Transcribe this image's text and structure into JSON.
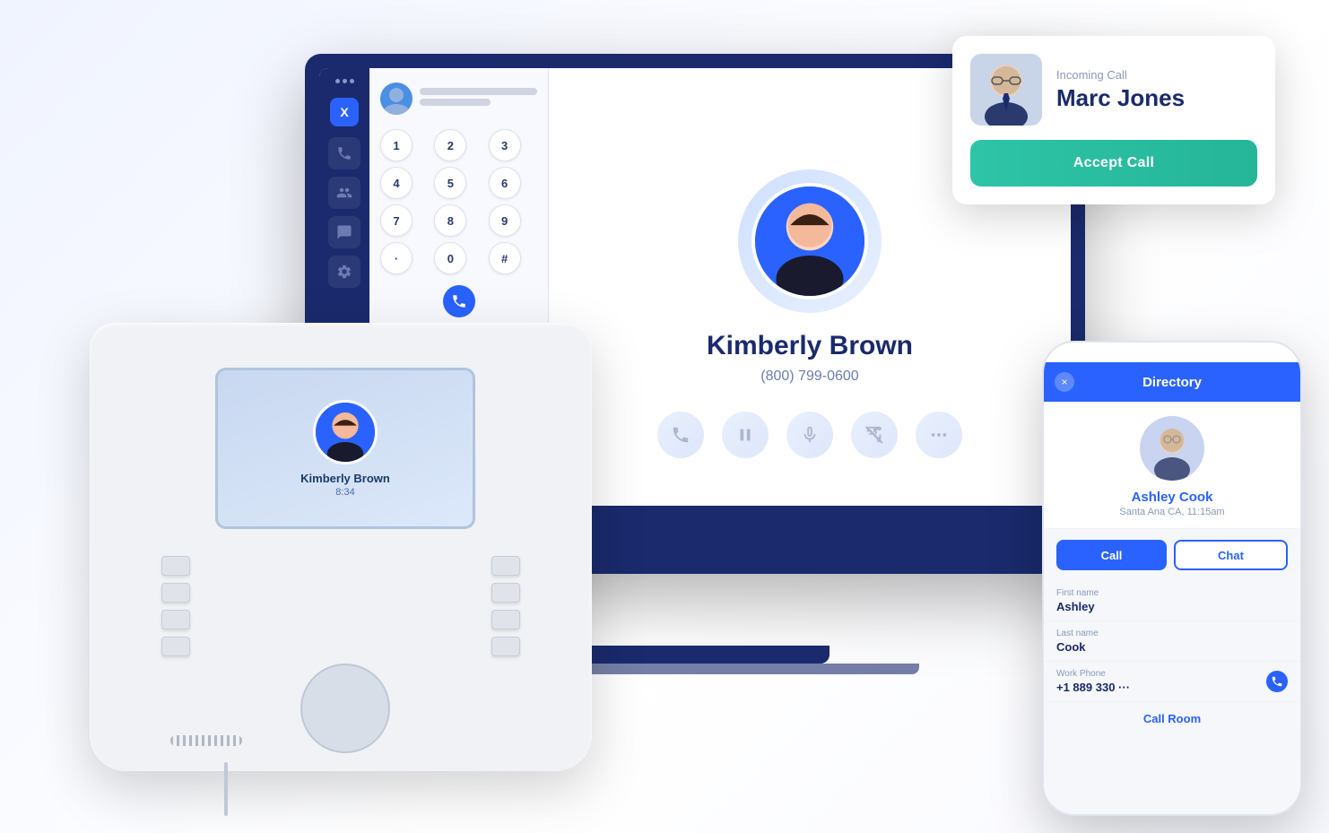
{
  "scene": {
    "bg": "#f5f8ff"
  },
  "incoming_call": {
    "label": "Incoming Call",
    "caller_name": "Marc Jones",
    "accept_label": "Accept Call"
  },
  "laptop": {
    "sidebar": {
      "logo": "X",
      "dots_label": "menu"
    },
    "dialer": {
      "keys": [
        "1",
        "2",
        "3",
        "4",
        "5",
        "6",
        "7",
        "8",
        "9",
        "·",
        "0",
        "#"
      ],
      "call_icon": "phone"
    },
    "contact": {
      "name": "Kimberly Brown",
      "phone": "(800) 799-0600",
      "action_icons": [
        "phone",
        "pause",
        "mute",
        "end",
        "more"
      ]
    }
  },
  "deskphone": {
    "contact_name": "Kimberly Brown",
    "timer": "8:34"
  },
  "mobile": {
    "header_title": "Directory",
    "close_icon": "×",
    "contact": {
      "name": "Ashley Cook",
      "location": "Santa Ana CA, 11:15am",
      "first_name_label": "First name",
      "first_name": "Ashley",
      "last_name_label": "Last name",
      "last_name": "Cook",
      "work_phone_label": "Work Phone",
      "work_phone": "+1 889 330 ···",
      "call_btn": "Call",
      "chat_btn": "Chat",
      "call_room_label": "Call Room"
    }
  }
}
